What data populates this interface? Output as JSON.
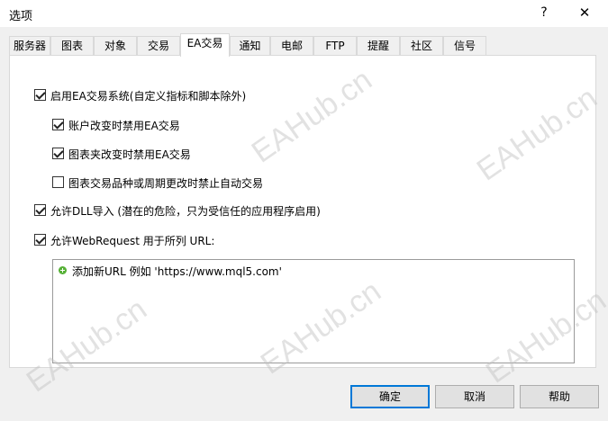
{
  "window": {
    "title": "选项",
    "help": "?",
    "close": "✕"
  },
  "tabs": [
    {
      "label": "服务器"
    },
    {
      "label": "图表"
    },
    {
      "label": "对象"
    },
    {
      "label": "交易"
    },
    {
      "label": "EA交易"
    },
    {
      "label": "通知"
    },
    {
      "label": "电邮"
    },
    {
      "label": "FTP"
    },
    {
      "label": "提醒"
    },
    {
      "label": "社区"
    },
    {
      "label": "信号"
    }
  ],
  "active_tab": "EA交易",
  "options": {
    "enable_ea": {
      "label": "启用EA交易系统(自定义指标和脚本除外)",
      "checked": true
    },
    "disable_account_change": {
      "label": "账户改变时禁用EA交易",
      "checked": true
    },
    "disable_profile_change": {
      "label": "图表夹改变时禁用EA交易",
      "checked": true
    },
    "disable_symbol_period_change": {
      "label": "图表交易品种或周期更改时禁止自动交易",
      "checked": false
    },
    "allow_dll": {
      "label": "允许DLL导入 (潜在的危险，只为受信任的应用程序启用)",
      "checked": true
    },
    "allow_webrequest": {
      "label": "允许WebRequest 用于所列 URL:",
      "checked": true
    }
  },
  "url_list": {
    "add_label": "添加新URL 例如 'https://www.mql5.com'",
    "icon": "plus-icon"
  },
  "buttons": {
    "ok": "确定",
    "cancel": "取消",
    "help": "帮助"
  },
  "watermark": "EAHub.cn"
}
